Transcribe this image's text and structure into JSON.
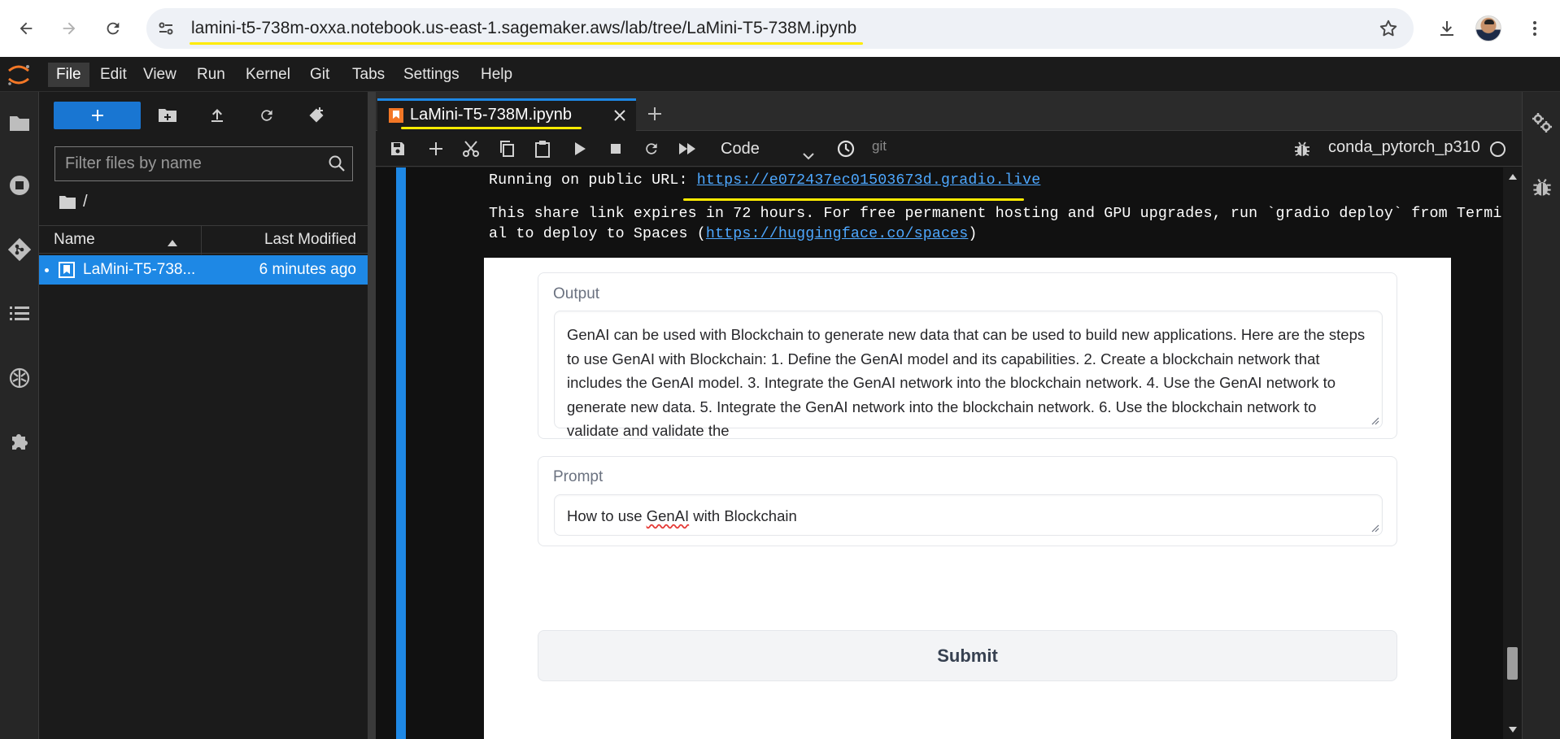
{
  "browser": {
    "url": "lamini-t5-738m-oxxa.notebook.us-east-1.sagemaker.aws/lab/tree/LaMini-T5-738M.ipynb"
  },
  "menubar": {
    "items": [
      "File",
      "Edit",
      "View",
      "Run",
      "Kernel",
      "Git",
      "Tabs",
      "Settings",
      "Help"
    ]
  },
  "filebrowser": {
    "filter_placeholder": "Filter files by name",
    "breadcrumb": "/",
    "col_name": "Name",
    "col_modified": "Last Modified",
    "files": [
      {
        "name": "LaMini-T5-738M.ipynb",
        "display_name": "LaMini-T5-738...",
        "modified": "6 minutes ago"
      }
    ]
  },
  "notebook": {
    "tab_label": "LaMini-T5-738M.ipynb",
    "cell_type": "Code",
    "git_label": "git",
    "kernel_name": "conda_pytorch_p310"
  },
  "output": {
    "public_url_label": "Running on public URL: ",
    "public_url": "https://e072437ec01503673d.gradio.live",
    "share_line_1": "This share link expires in 72 hours. For free permanent hosting and GPU upgrades, run `gradio deploy` from Termin",
    "share_line_2_prefix": "al to deploy to Spaces (",
    "spaces_url": "https://huggingface.co/spaces",
    "share_line_2_suffix": ")"
  },
  "gradio": {
    "output_label": "Output",
    "output_text": "GenAI can be used with Blockchain to generate new data that can be used to build new applications. Here are the steps to use GenAI with Blockchain: 1. Define the GenAI model and its capabilities. 2. Create a blockchain network that includes the GenAI model. 3. Integrate the GenAI network into the blockchain network. 4. Use the GenAI network to generate new data. 5. Integrate the GenAI network into the blockchain network. 6. Use the blockchain network to validate and validate the",
    "prompt_label": "Prompt",
    "prompt_before": "How to use ",
    "prompt_misspelled": "GenAI",
    "prompt_after": " with Blockchain",
    "submit_label": "Submit"
  },
  "colors": {
    "accent": "#1e88e5",
    "highlight": "#ffeb00",
    "link": "#4ea8ff"
  }
}
